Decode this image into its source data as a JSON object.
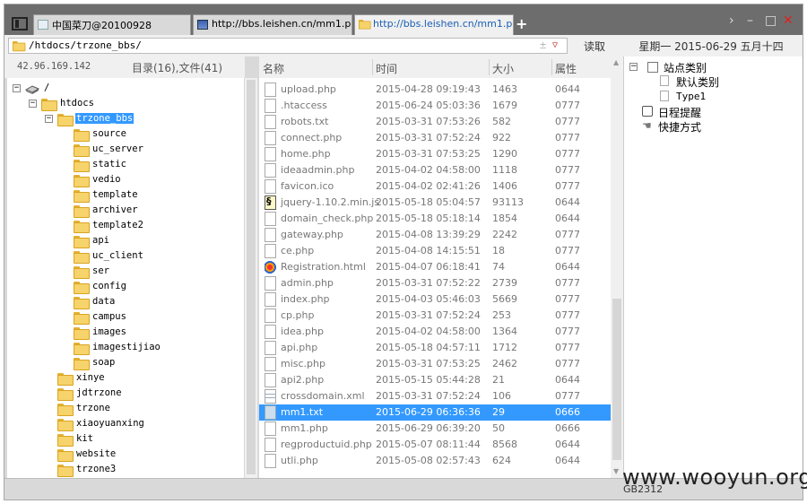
{
  "tabs": [
    {
      "label": "中国菜刀@20100928"
    },
    {
      "label": "http://bbs.leishen.cn/mm1.php"
    },
    {
      "label": "http://bbs.leishen.cn/mm1.php"
    }
  ],
  "new_tab_label": "+",
  "window_controls": {
    "chevron": "›",
    "minimize": "–",
    "maximize": "□",
    "close": "✕"
  },
  "address": {
    "path": "/htdocs/trzone_bbs/",
    "plus": "±",
    "dropdown": "▽",
    "read_button": "读取"
  },
  "date_display": "星期一 2015-06-29 五月十四",
  "left_panel": {
    "ip": "42.96.169.142",
    "dir_stats": "目录(16),文件(41)"
  },
  "tree": [
    {
      "label": "/",
      "expander": "−",
      "icon": "drive-icon"
    },
    {
      "label": "htdocs",
      "expander": "−",
      "icon": "folder-icon"
    },
    {
      "label": "trzone_bbs",
      "expander": "−",
      "icon": "folder-open-icon",
      "selected": true
    },
    {
      "label": "source"
    },
    {
      "label": "uc_server"
    },
    {
      "label": "static"
    },
    {
      "label": "vedio"
    },
    {
      "label": "template"
    },
    {
      "label": "archiver"
    },
    {
      "label": "template2"
    },
    {
      "label": "api"
    },
    {
      "label": "uc_client"
    },
    {
      "label": "ser"
    },
    {
      "label": "config"
    },
    {
      "label": "data"
    },
    {
      "label": "campus"
    },
    {
      "label": "images"
    },
    {
      "label": "imagestijiao"
    },
    {
      "label": "soap"
    },
    {
      "label": "xinye"
    },
    {
      "label": "jdtrzone"
    },
    {
      "label": "trzone"
    },
    {
      "label": "xiaoyuanxing"
    },
    {
      "label": "kit"
    },
    {
      "label": "website"
    },
    {
      "label": "trzone3"
    }
  ],
  "file_list": {
    "columns": {
      "name": "名称",
      "time": "时间",
      "size": "大小",
      "attr": "属性"
    },
    "rows": [
      {
        "name": "upload.php",
        "time": "2015-04-28 09:19:43",
        "size": "1463",
        "attr": "0644",
        "icon": "file"
      },
      {
        "name": ".htaccess",
        "time": "2015-06-24 05:03:36",
        "size": "1679",
        "attr": "0777",
        "icon": "file"
      },
      {
        "name": "robots.txt",
        "time": "2015-03-31 07:53:26",
        "size": "582",
        "attr": "0777",
        "icon": "file"
      },
      {
        "name": "connect.php",
        "time": "2015-03-31 07:52:24",
        "size": "922",
        "attr": "0777",
        "icon": "file"
      },
      {
        "name": "home.php",
        "time": "2015-03-31 07:53:25",
        "size": "1290",
        "attr": "0777",
        "icon": "file"
      },
      {
        "name": "ideaadmin.php",
        "time": "2015-04-02 04:58:00",
        "size": "1118",
        "attr": "0777",
        "icon": "file"
      },
      {
        "name": "favicon.ico",
        "time": "2015-04-02 02:41:26",
        "size": "1406",
        "attr": "0777",
        "icon": "file"
      },
      {
        "name": "jquery-1.10.2.min.js",
        "time": "2015-05-18 05:04:57",
        "size": "93113",
        "attr": "0644",
        "icon": "js"
      },
      {
        "name": "domain_check.php",
        "time": "2015-05-18 05:18:14",
        "size": "1854",
        "attr": "0644",
        "icon": "file"
      },
      {
        "name": "gateway.php",
        "time": "2015-04-08 13:39:29",
        "size": "2242",
        "attr": "0777",
        "icon": "file"
      },
      {
        "name": "ce.php",
        "time": "2015-04-08 14:15:51",
        "size": "18",
        "attr": "0777",
        "icon": "file"
      },
      {
        "name": "Registration.html",
        "time": "2015-04-07 06:18:41",
        "size": "74",
        "attr": "0644",
        "icon": "html"
      },
      {
        "name": "admin.php",
        "time": "2015-03-31 07:52:22",
        "size": "2739",
        "attr": "0777",
        "icon": "file"
      },
      {
        "name": "index.php",
        "time": "2015-04-03 05:46:03",
        "size": "5669",
        "attr": "0777",
        "icon": "file"
      },
      {
        "name": "cp.php",
        "time": "2015-03-31 07:52:24",
        "size": "253",
        "attr": "0777",
        "icon": "file"
      },
      {
        "name": "idea.php",
        "time": "2015-04-02 04:58:00",
        "size": "1364",
        "attr": "0777",
        "icon": "file"
      },
      {
        "name": "api.php",
        "time": "2015-05-18 04:57:11",
        "size": "1712",
        "attr": "0777",
        "icon": "file"
      },
      {
        "name": "misc.php",
        "time": "2015-03-31 07:53:25",
        "size": "2462",
        "attr": "0777",
        "icon": "file"
      },
      {
        "name": "api2.php",
        "time": "2015-05-15 05:44:28",
        "size": "21",
        "attr": "0644",
        "icon": "file"
      },
      {
        "name": "crossdomain.xml",
        "time": "2015-03-31 07:52:24",
        "size": "106",
        "attr": "0777",
        "icon": "xml"
      },
      {
        "name": "mm1.txt",
        "time": "2015-06-29 06:36:36",
        "size": "29",
        "attr": "0666",
        "icon": "file",
        "selected": true
      },
      {
        "name": "mm1.php",
        "time": "2015-06-29 06:39:20",
        "size": "50",
        "attr": "0666",
        "icon": "file"
      },
      {
        "name": "regproductuid.php",
        "time": "2015-05-07 08:11:44",
        "size": "8568",
        "attr": "0644",
        "icon": "file"
      },
      {
        "name": "utli.php",
        "time": "2015-05-08 02:57:43",
        "size": "624",
        "attr": "0644",
        "icon": "file"
      }
    ]
  },
  "site_panel": {
    "root": "站点类别",
    "default_category": "默认类别",
    "type1": "Type1",
    "schedule": "日程提醒",
    "shortcuts": "快捷方式"
  },
  "status": {
    "encoding": "GB2312"
  },
  "watermark": "www.wooyun.org",
  "colors": {
    "selection": "#3399ff",
    "tab_link": "#1a5fb4",
    "close_button": "#e02020"
  }
}
